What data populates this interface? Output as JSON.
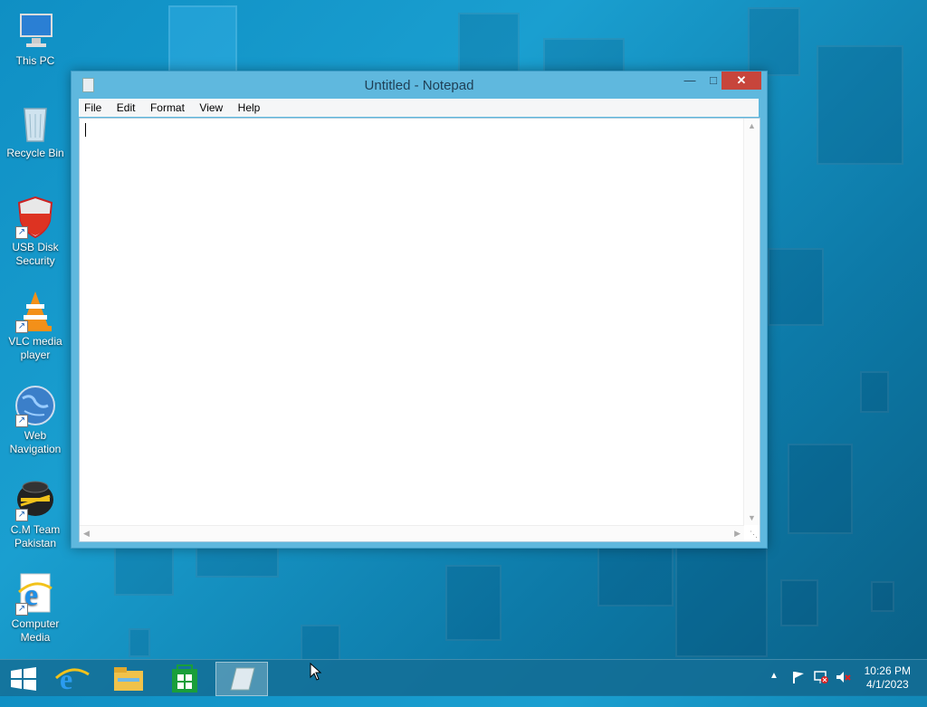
{
  "desktop": {
    "icons": [
      {
        "label": "This PC",
        "icon": "this-pc-icon"
      },
      {
        "label": "Recycle Bin",
        "icon": "recycle-bin-icon"
      },
      {
        "label": "USB Disk Security",
        "icon": "usb-disk-security-icon"
      },
      {
        "label": "VLC media player",
        "icon": "vlc-icon"
      },
      {
        "label": "Web Navigation",
        "icon": "globe-icon"
      },
      {
        "label": "C.M Team Pakistan",
        "icon": "cm-team-icon"
      },
      {
        "label": "Computer Media",
        "icon": "internet-explorer-icon"
      }
    ]
  },
  "notepad": {
    "title": "Untitled - Notepad",
    "menu": [
      "File",
      "Edit",
      "Format",
      "View",
      "Help"
    ],
    "content": "",
    "controls": {
      "minimize": "minimize-icon",
      "maximize": "maximize-icon",
      "close": "close-icon"
    }
  },
  "taskbar": {
    "start": "windows-start-icon",
    "pinned": [
      "internet-explorer-icon",
      "file-explorer-icon",
      "windows-store-icon",
      "notepad-icon"
    ],
    "tray_icons": [
      "show-hidden-icons-icon",
      "action-center-flag-icon",
      "network-icon",
      "volume-muted-icon"
    ],
    "time": "10:26 PM",
    "date": "4/1/2023"
  },
  "colors": {
    "close_button": "#c7453b",
    "window_frame": "#5fb8de",
    "desktop": "#1a9fd0"
  }
}
